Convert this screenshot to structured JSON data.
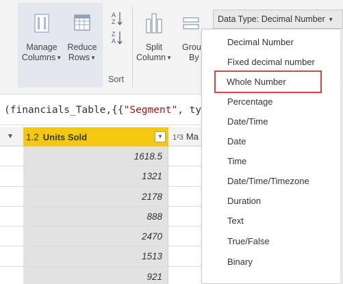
{
  "ribbon": {
    "manage_columns": {
      "line1": "Manage",
      "line2": "Columns"
    },
    "reduce_rows": {
      "line1": "Reduce",
      "line2": "Rows"
    },
    "sort_label": "Sort",
    "split_column": {
      "line1": "Split",
      "line2": "Column"
    },
    "group_by": {
      "line1": "Grou",
      "line2": "By"
    },
    "data_type_button": "Data Type: Decimal Number"
  },
  "formula_bar": {
    "prefix": "(financials_Table,{{",
    "string": "\"Segment\"",
    "suffix": ", ty"
  },
  "grid": {
    "units_column": {
      "type_icon": "1.2",
      "name": "Units Sold"
    },
    "next_column": {
      "type_icon": "1²3",
      "name": "Ma"
    },
    "rows": [
      "1618.5",
      "1321",
      "2178",
      "888",
      "2470",
      "1513",
      "921"
    ]
  },
  "menu": {
    "items": [
      "Decimal Number",
      "Fixed decimal number",
      "Whole Number",
      "Percentage",
      "Date/Time",
      "Date",
      "Time",
      "Date/Time/Timezone",
      "Duration",
      "Text",
      "True/False",
      "Binary"
    ],
    "highlighted_index": 2
  },
  "colors": {
    "header_accent": "#f2c811",
    "highlight_outline": "#e0403a"
  }
}
